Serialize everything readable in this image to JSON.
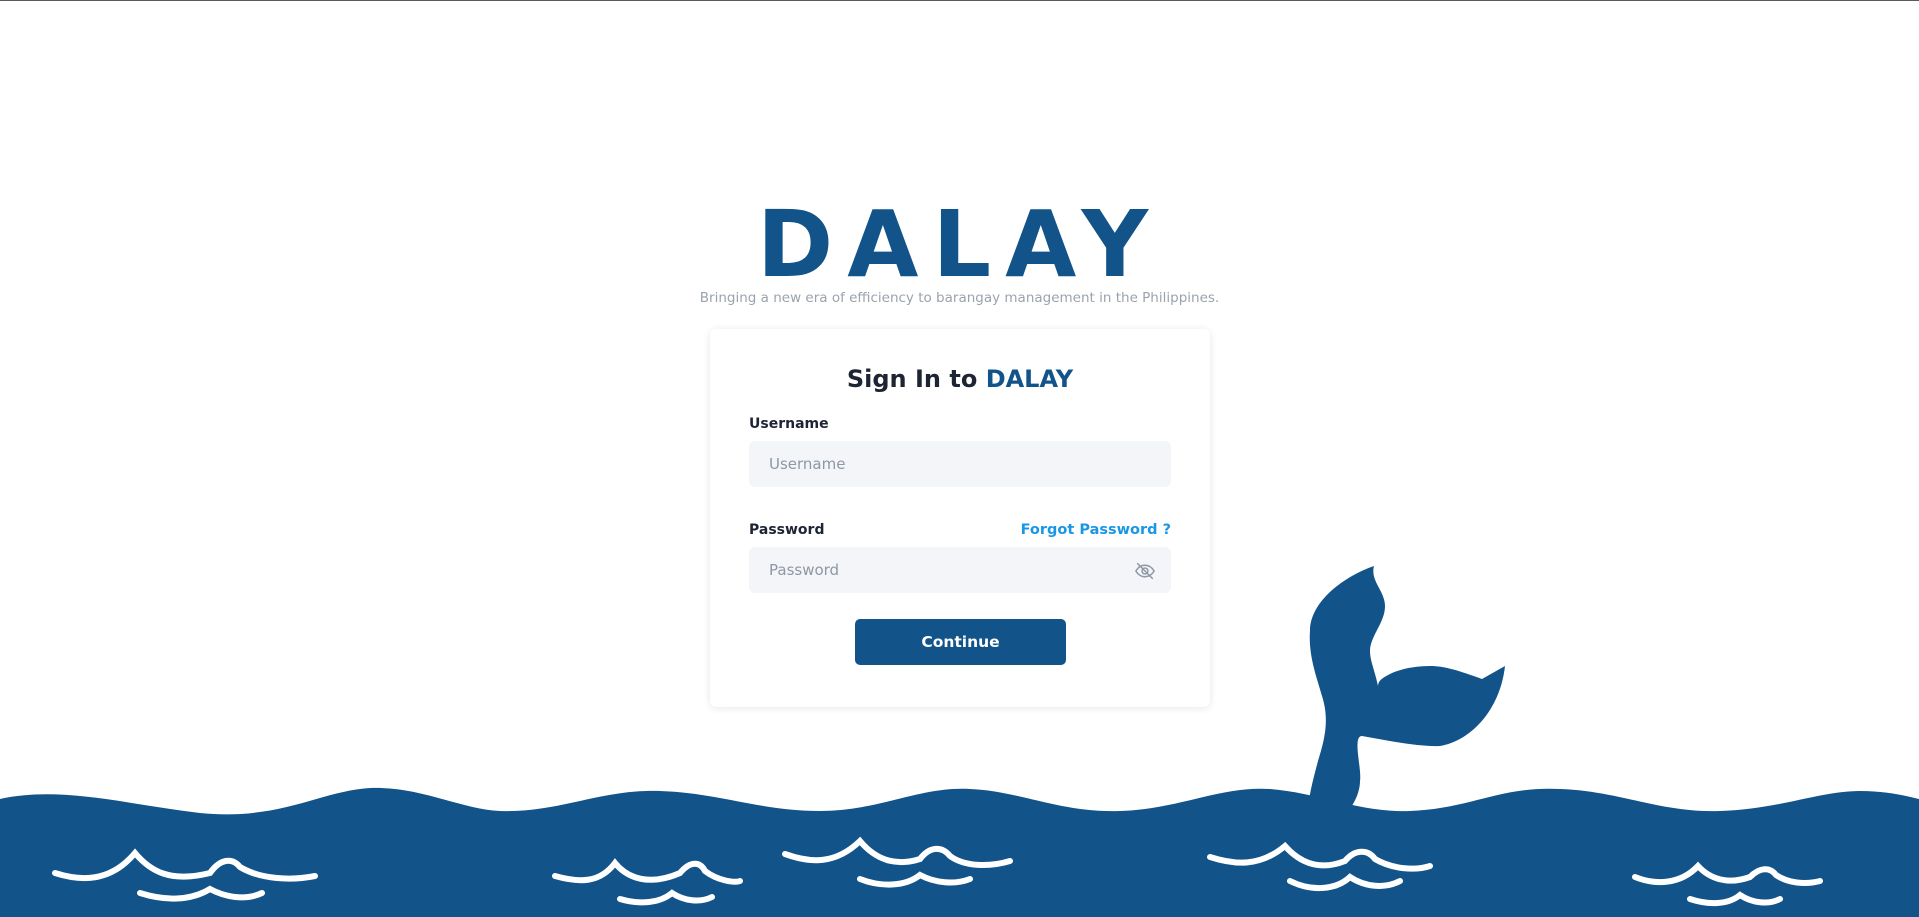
{
  "brand": {
    "logo_text": "DALAY",
    "tagline": "Bringing a new era of efficiency to barangay management in the Philippines."
  },
  "signin": {
    "title_prefix": "Sign In to",
    "title_brand": "DALAY",
    "username_label": "Username",
    "username_placeholder": "Username",
    "username_value": "",
    "password_label": "Password",
    "password_placeholder": "Password",
    "password_value": "",
    "forgot_label": "Forgot Password ?",
    "continue_label": "Continue",
    "password_toggle_icon": "eye-off-icon"
  },
  "decoration": {
    "illustration": "whale-tail-icon",
    "background": "ocean-waves"
  },
  "colors": {
    "brand": "#12538a",
    "link": "#1a96e6",
    "input_bg": "#f3f5f8",
    "tagline": "#9aa3ad",
    "title": "#1d2433"
  }
}
